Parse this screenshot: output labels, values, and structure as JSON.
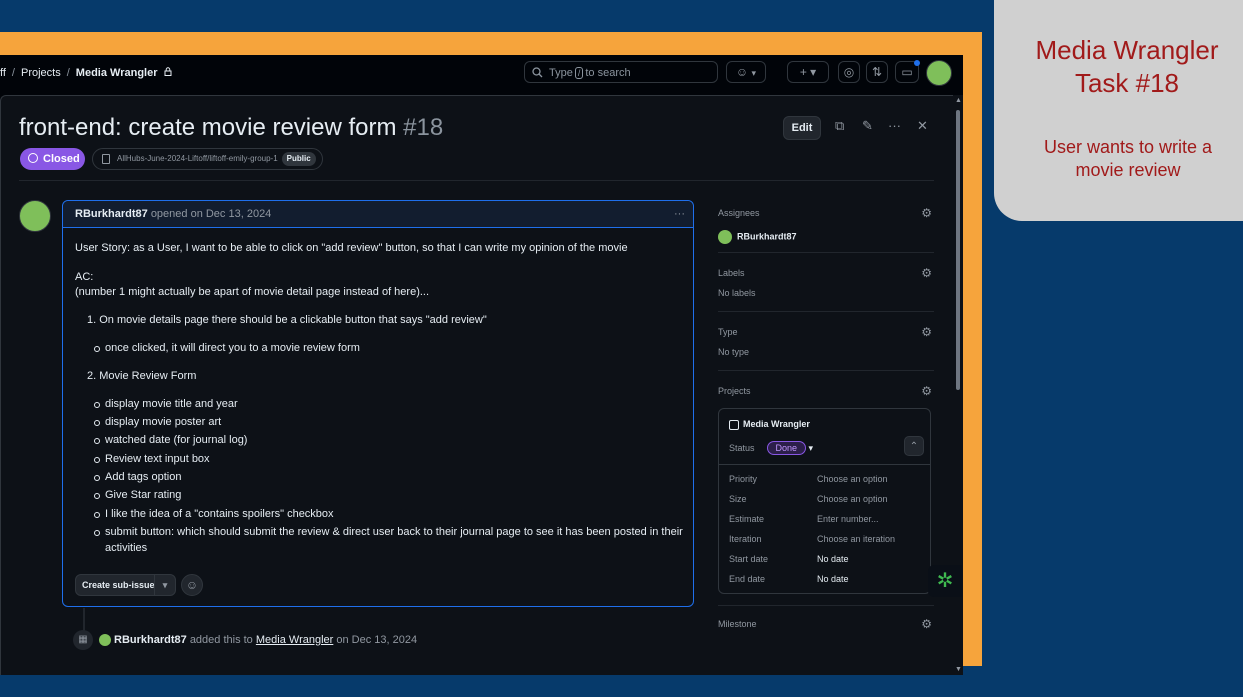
{
  "breadcrumb": {
    "part1": "ff",
    "sep1": "/",
    "projects": "Projects",
    "sep2": "/",
    "current": "Media Wrangler",
    "lock": "🔒"
  },
  "search": {
    "pre": "Type",
    "key": "/",
    "post": "to search"
  },
  "toolbar": {
    "copilot": "☺",
    "dropdown": "▾",
    "plus": "+ ▾",
    "issues": "◎",
    "pulls": "⇅",
    "inbox": "▭"
  },
  "issue": {
    "title": "front-end: create movie review form",
    "number": "#18",
    "state": "Closed",
    "repo": "AllHubs-June-2024-Liftoff/liftoff-emily-group-1",
    "visibility": "Public",
    "edit_label": "Edit"
  },
  "comment": {
    "author": "RBurkhardt87",
    "meta": "opened on Dec 13, 2024",
    "menu": "···",
    "story": "User Story: as a User, I want to be able to click on \"add review\" button, so that I can write my opinion of the movie",
    "ac": "AC:",
    "note": "(number 1 might actually be apart of movie detail page instead of here)...",
    "item1": "1. On movie details page there should be a clickable button that says \"add review\"",
    "item1_sub": "once clicked, it will direct you to a movie review form",
    "item2": "2. Movie Review Form",
    "item2_subs": [
      "display movie title and year",
      "display movie poster art",
      "watched date (for journal log)",
      "Review text input box",
      "Add tags option",
      "Give Star rating",
      "I like the idea of a \"contains spoilers\" checkbox",
      "submit button: which should submit the review & direct user back to their journal page to see it has been posted in their",
      "activities"
    ],
    "sub_issue_label": "Create sub-issue",
    "drop": "▾",
    "emoji": "☺"
  },
  "event": {
    "author": "RBurkhardt87",
    "text": "added this to",
    "project": "Media Wrangler",
    "date": "on Dec 13, 2024"
  },
  "sidebar": {
    "assignees_label": "Assignees",
    "assignee": "RBurkhardt87",
    "labels_label": "Labels",
    "labels_value": "No labels",
    "type_label": "Type",
    "type_value": "No type",
    "projects_label": "Projects",
    "project_name": "Media Wrangler",
    "status_label": "Status",
    "status_value": "Done",
    "fields": [
      {
        "k": "Priority",
        "v": "Choose an option"
      },
      {
        "k": "Size",
        "v": "Choose an option"
      },
      {
        "k": "Estimate",
        "v": "Enter number..."
      },
      {
        "k": "Iteration",
        "v": "Choose an iteration"
      },
      {
        "k": "Start date",
        "v": "No date"
      },
      {
        "k": "End date",
        "v": "No date"
      }
    ],
    "milestone_label": "Milestone"
  },
  "card": {
    "title": "Media Wrangler Task #18",
    "subtitle": "User wants to write a movie review"
  },
  "colors": {
    "accent": "#f6a43c",
    "closed": "#8957e5",
    "background": "#063a6b",
    "card_text": "#a11a1a"
  }
}
